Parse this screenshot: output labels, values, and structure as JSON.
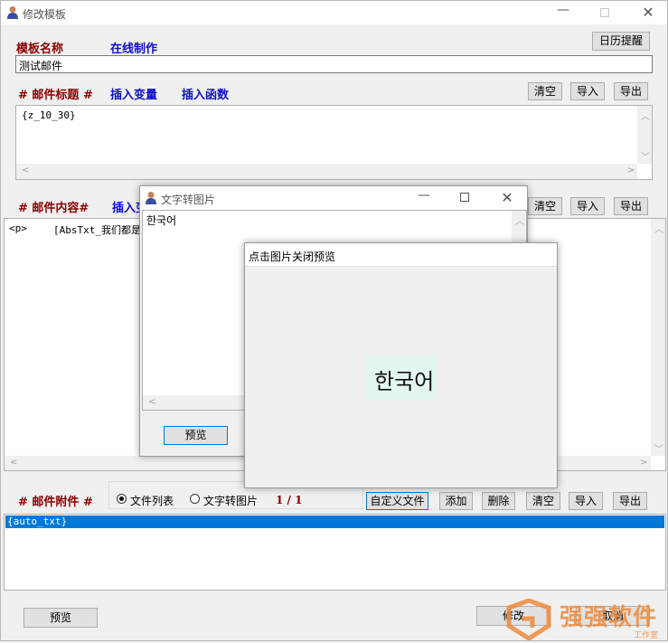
{
  "main": {
    "title": "修改模板",
    "template_name_label": "模板名称",
    "online_make": "在线制作",
    "calendar_btn": "日历提醒",
    "template_name_value": "测试邮件",
    "subject_label": "# 邮件标题 #",
    "insert_variable": "插入变量",
    "insert_function": "插入函数",
    "clear": "清空",
    "import": "导入",
    "export": "导出",
    "subject_value": "{z_10_30}",
    "content_label": "# 邮件内容#",
    "insert_variable_cut": "插入变",
    "content_line_tag": "<p>",
    "content_line_text": "[AbsTxt_我们都是爱",
    "attach_label": "# 邮件附件 #",
    "radio_file_list": "文件列表",
    "radio_text_to_img": "文字转图片",
    "page_indicator": "1 / 1",
    "custom_file": "自定义文件",
    "add": "添加",
    "delete": "删除",
    "attach_item": "{auto_txt}",
    "preview_btn": "预览",
    "modify_btn": "修改",
    "cancel_btn": "取消",
    "watermark_cn": "强强软件",
    "watermark_sub": "工作室"
  },
  "text_to_image": {
    "title": "文字转图片",
    "text_value": "한국어",
    "preview_btn": "预览"
  },
  "preview_popup": {
    "title": "点击图片关闭预览",
    "image_text": "한국어"
  },
  "colors": {
    "accent_select": "#0078d7",
    "label_red": "#8b0000",
    "label_blue": "#1010c8",
    "watermark": "#f08a3c"
  }
}
